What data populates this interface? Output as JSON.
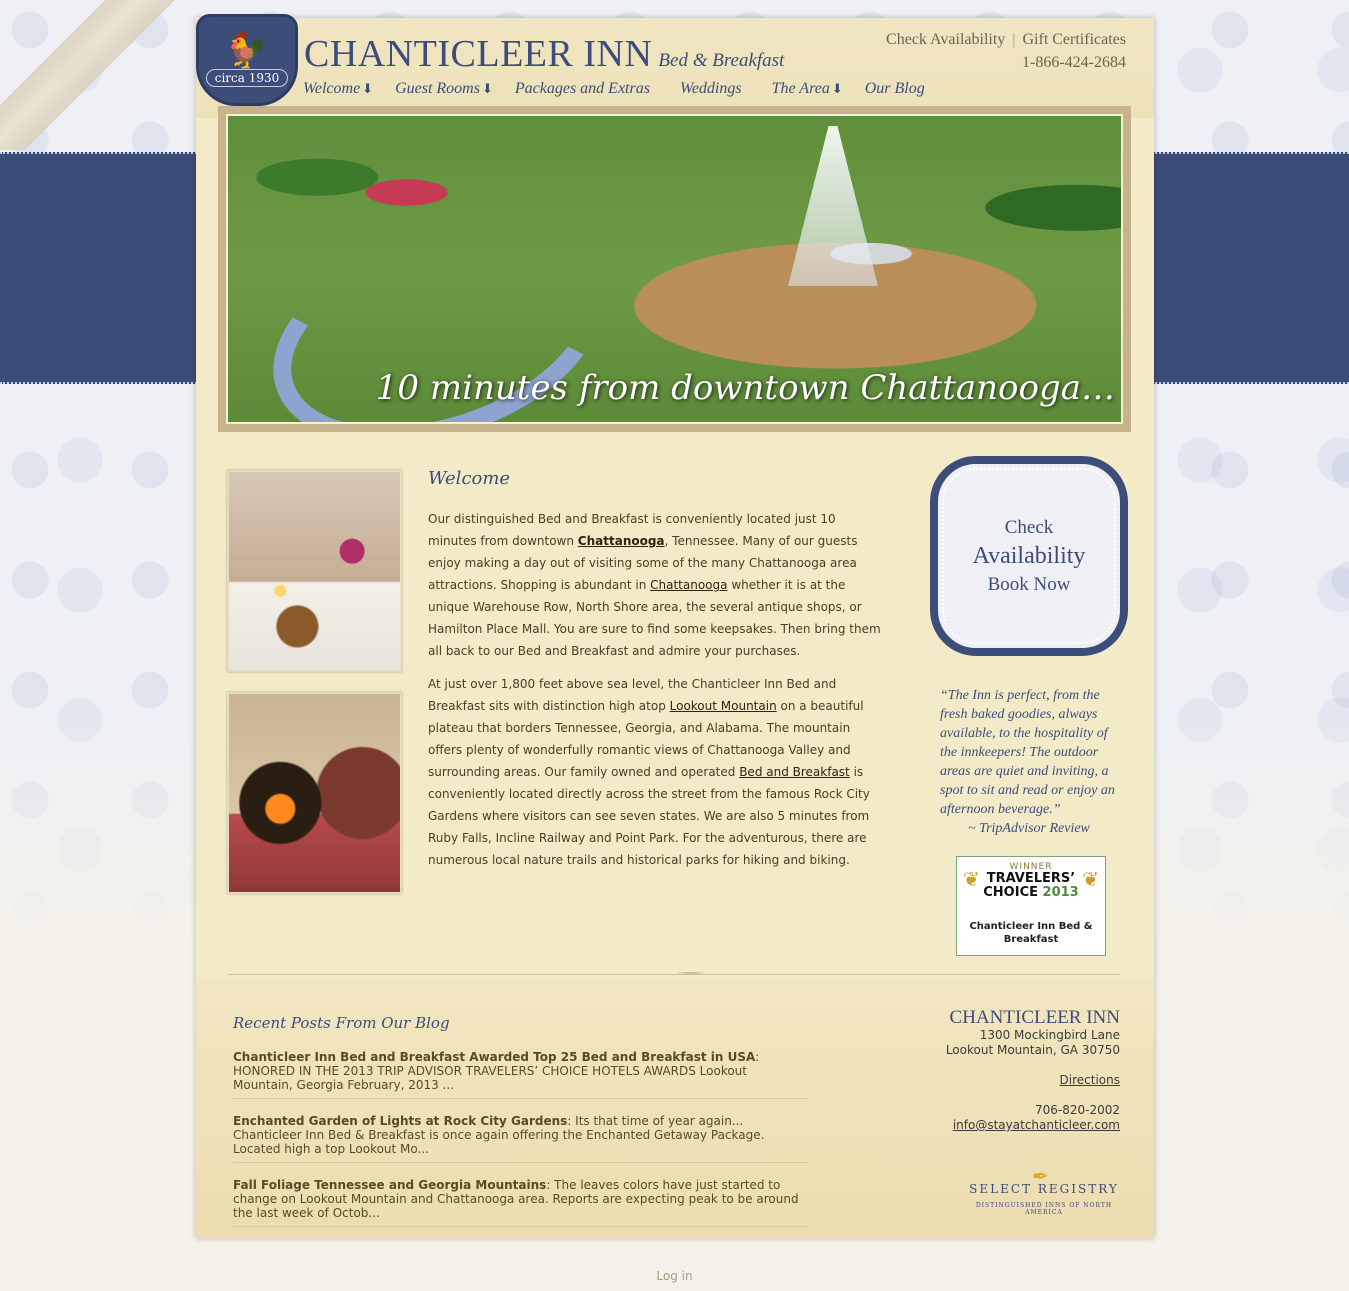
{
  "header": {
    "logo_text": "circa 1930",
    "brand_name": "CHANTICLEER INN",
    "brand_sub": "Bed & Breakfast",
    "top_links": {
      "check_availability": "Check Availability",
      "separator": "|",
      "gift_certificates": "Gift Certificates",
      "phone": "1-866-424-2684"
    },
    "nav": [
      {
        "label": "Welcome",
        "has_dropdown": true
      },
      {
        "label": "Guest Rooms",
        "has_dropdown": true
      },
      {
        "label": "Packages and Extras",
        "has_dropdown": false
      },
      {
        "label": "Weddings",
        "has_dropdown": false
      },
      {
        "label": "The Area",
        "has_dropdown": true
      },
      {
        "label": "Our Blog",
        "has_dropdown": false
      }
    ]
  },
  "hero": {
    "caption": "10 minutes from downtown Chattanooga…"
  },
  "welcome": {
    "title": "Welcome",
    "p1_a": "Our distinguished Bed and Breakfast is conveniently located just 10 minutes from downtown ",
    "p1_link1": "Chattanooga",
    "p1_b": ", Tennessee. Many of our guests enjoy making a day out of visiting some of the many Chattanooga area attractions. Shopping is abundant in ",
    "p1_link2": "Chattanooga",
    "p1_c": " whether it is at the unique Warehouse Row, North Shore area, the several antique shops, or Hamilton Place Mall. You are sure to find some keepsakes.  Then bring them all back to our Bed and Breakfast and admire your purchases.",
    "p2_a": "At just over 1,800 feet above sea level, the Chanticleer Inn Bed and Breakfast sits with distinction high atop ",
    "p2_link1": "Lookout Mountain",
    "p2_b": " on a beautiful plateau that borders Tennessee, Georgia, and Alabama. The mountain offers plenty of wonderfully romantic views of Chattanooga Valley and surrounding areas. Our family owned and operated ",
    "p2_link2": "Bed and Breakfast",
    "p2_c": " is conveniently located directly across the street from the famous Rock City Gardens where visitors can see seven states. We are also 5 minutes from Ruby Falls, Incline Railway and Point Park. For the adventurous, there are numerous local nature trails and historical parks for hiking and biking."
  },
  "sidebar": {
    "avail_line1": "Check",
    "avail_line2": "Availability",
    "avail_line3": "Book Now",
    "quote": "“The Inn is perfect, from the fresh baked goodies, always available, to the hospitality of the innkeepers! The outdoor areas are quiet and inviting, a spot to sit and read or enjoy an afternoon beverage.”",
    "quote_source": "~ TripAdvisor Review",
    "award": {
      "winner": "WINNER",
      "line1": "TRAVELERS’",
      "line2": "CHOICE",
      "year": "2013",
      "name": "Chanticleer Inn Bed & Breakfast"
    }
  },
  "blog": {
    "title": "Recent Posts From Our Blog",
    "posts": [
      {
        "title": "Chanticleer Inn Bed and Breakfast Awarded Top 25 Bed and Breakfast in USA",
        "excerpt": ": HONORED IN THE 2013 TRIP ADVISOR TRAVELERS’ CHOICE HOTELS AWARDS Lookout Mountain, Georgia February, 2013 ..."
      },
      {
        "title": "Enchanted Garden of Lights at Rock City Gardens",
        "excerpt": ": Its that time of year again... Chanticleer Inn Bed & Breakfast is once again offering the Enchanted Getaway Package. Located high a top Lookout Mo..."
      },
      {
        "title": "Fall Foliage Tennessee and Georgia Mountains",
        "excerpt": ": The leaves colors have just started to change on Lookout Mountain and Chattanooga area. Reports are expecting peak to be around the last week of Octob..."
      }
    ]
  },
  "contact": {
    "name": "CHANTICLEER INN",
    "street": "1300 Mockingbird Lane",
    "city": "Lookout Mountain, GA 30750",
    "directions": "Directions",
    "phone": "706-820-2002",
    "email": "info@stayatchanticleer.com"
  },
  "select_registry": {
    "name": "SELECT REGISTRY",
    "tagline": "DISTINGUISHED INNS OF NORTH AMERICA"
  },
  "footer": {
    "login": "Log in"
  },
  "colors": {
    "navy": "#3d4d79",
    "parchment": "#f3ebc8",
    "text": "#4a3d20"
  }
}
